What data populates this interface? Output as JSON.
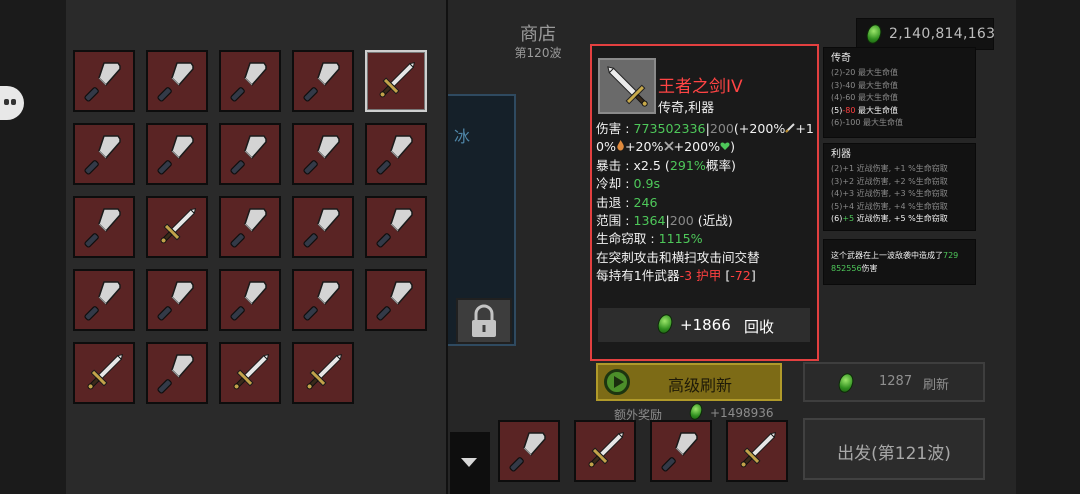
{
  "shop": {
    "title": "商店",
    "wave": "第120波"
  },
  "currency": {
    "amount": "2,140,814,163",
    "icon": "green-gem-icon"
  },
  "inventory": {
    "items": [
      "cleaver",
      "cleaver",
      "cleaver",
      "cleaver",
      "sword",
      "cleaver",
      "cleaver",
      "cleaver",
      "cleaver",
      "cleaver",
      "cleaver",
      "sword",
      "cleaver",
      "cleaver",
      "cleaver",
      "cleaver",
      "cleaver",
      "cleaver",
      "cleaver",
      "cleaver",
      "sword",
      "cleaver",
      "sword",
      "sword"
    ],
    "selected_index": 4
  },
  "partial_card_text": "冰",
  "tooltip": {
    "name": "王者之剑IV",
    "type": "传奇,利器",
    "dmg_label": "伤害 : ",
    "dmg_value": "773502336",
    "dmg_sep": "|",
    "dmg_base": "200",
    "dmg_bonus_1": "(+200%",
    "dmg_bonus_2": "+1",
    "dmg_bonus_3": "0%",
    "dmg_bonus_4": "+20%",
    "dmg_bonus_5": "+200%",
    "dmg_bonus_6": ")",
    "crit_label": "暴击 : ",
    "crit_value": "x2.5",
    "crit_open": " (",
    "crit_pct": "291%",
    "crit_suffix": "概率)",
    "cd_label": "冷却 : ",
    "cd_value": "0.9s",
    "kb_label": "击退 : ",
    "kb_value": "246",
    "range_label": "范围 : ",
    "range_value": "1364",
    "range_sep": "|",
    "range_base": "200",
    "range_suffix": " (近战)",
    "ls_label": "生命窃取 : ",
    "ls_value": "1115%",
    "desc1": "在突刺攻击和横扫攻击间交替",
    "desc2_a": "每持有1件武器",
    "desc2_b": "-3 护甲",
    "desc2_c": " [",
    "desc2_d": "-72",
    "desc2_e": "]",
    "sell_value": "+1866",
    "sell_label": "回收"
  },
  "sets": {
    "legendary": {
      "title": "传奇",
      "lines": [
        "(2)-20 最大生命值",
        "(3)-40 最大生命值",
        "(4)-60 最大生命值",
        "(5)-80 最大生命值",
        "(6)-100 最大生命值"
      ],
      "active_index": 3
    },
    "sharp": {
      "title": "利器",
      "lines": [
        "(2)+1 近战伤害, +1 %生命窃取",
        "(3)+2 近战伤害, +2 %生命窃取",
        "(4)+3 近战伤害, +3 %生命窃取",
        "(5)+4 近战伤害, +4 %生命窃取",
        "(6)+5 近战伤害, +5 %生命窃取"
      ],
      "active_index": 4
    },
    "last_wave": {
      "text1": "这个武器在上一波敌袭中造成了",
      "dmg1": "729",
      "dmg2": "852556",
      "text2": "伤害"
    }
  },
  "buttons": {
    "refresh": "高级刷新",
    "refresh_cost": "1287",
    "refresh_label": "刷新",
    "next_wave": "出发(第121波)"
  },
  "bonus": {
    "label": "额外奖励",
    "value": "+1498936"
  },
  "shop_items": [
    "cleaver",
    "sword",
    "cleaver",
    "sword"
  ]
}
